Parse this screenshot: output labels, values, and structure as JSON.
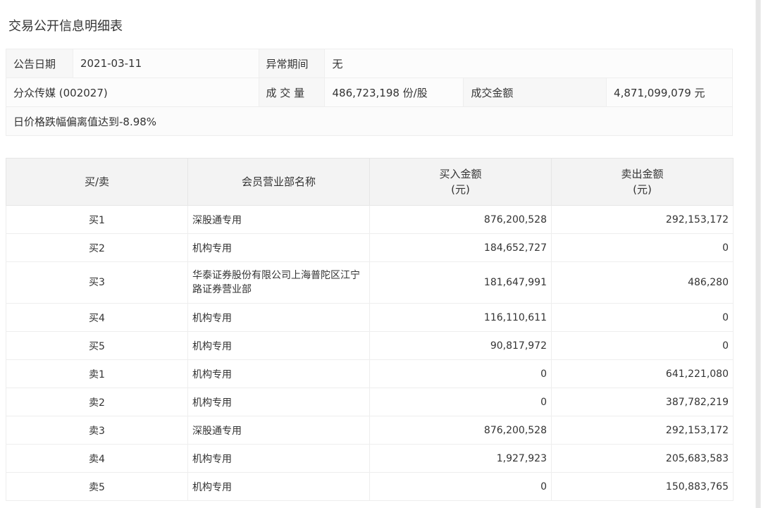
{
  "page_title": "交易公开信息明细表",
  "info": {
    "announce_date_label": "公告日期",
    "announce_date_value": "2021-03-11",
    "abnormal_period_label": "异常期间",
    "abnormal_period_value": "无",
    "stock_name": "分众传媒 (002027)",
    "volume_label": "成 交 量",
    "volume_value": "486,723,198 份/股",
    "amount_label": "成交金额",
    "amount_value": "4,871,099,079 元",
    "reason": "日价格跌幅偏离值达到-8.98%"
  },
  "table": {
    "headers": {
      "side": "买/卖",
      "member": "会员营业部名称",
      "buy_amount_line1": "买入金额",
      "buy_amount_line2": "(元)",
      "sell_amount_line1": "卖出金额",
      "sell_amount_line2": "(元)"
    },
    "rows": [
      {
        "side": "买1",
        "name": "深股通专用",
        "buy": "876,200,528",
        "sell": "292,153,172"
      },
      {
        "side": "买2",
        "name": "机构专用",
        "buy": "184,652,727",
        "sell": "0"
      },
      {
        "side": "买3",
        "name": "华泰证券股份有限公司上海普陀区江宁路证券营业部",
        "buy": "181,647,991",
        "sell": "486,280"
      },
      {
        "side": "买4",
        "name": "机构专用",
        "buy": "116,110,611",
        "sell": "0"
      },
      {
        "side": "买5",
        "name": "机构专用",
        "buy": "90,817,972",
        "sell": "0"
      },
      {
        "side": "卖1",
        "name": "机构专用",
        "buy": "0",
        "sell": "641,221,080"
      },
      {
        "side": "卖2",
        "name": "机构专用",
        "buy": "0",
        "sell": "387,782,219"
      },
      {
        "side": "卖3",
        "name": "深股通专用",
        "buy": "876,200,528",
        "sell": "292,153,172"
      },
      {
        "side": "卖4",
        "name": "机构专用",
        "buy": "1,927,923",
        "sell": "205,683,583"
      },
      {
        "side": "卖5",
        "name": "机构专用",
        "buy": "0",
        "sell": "150,883,765"
      }
    ]
  }
}
